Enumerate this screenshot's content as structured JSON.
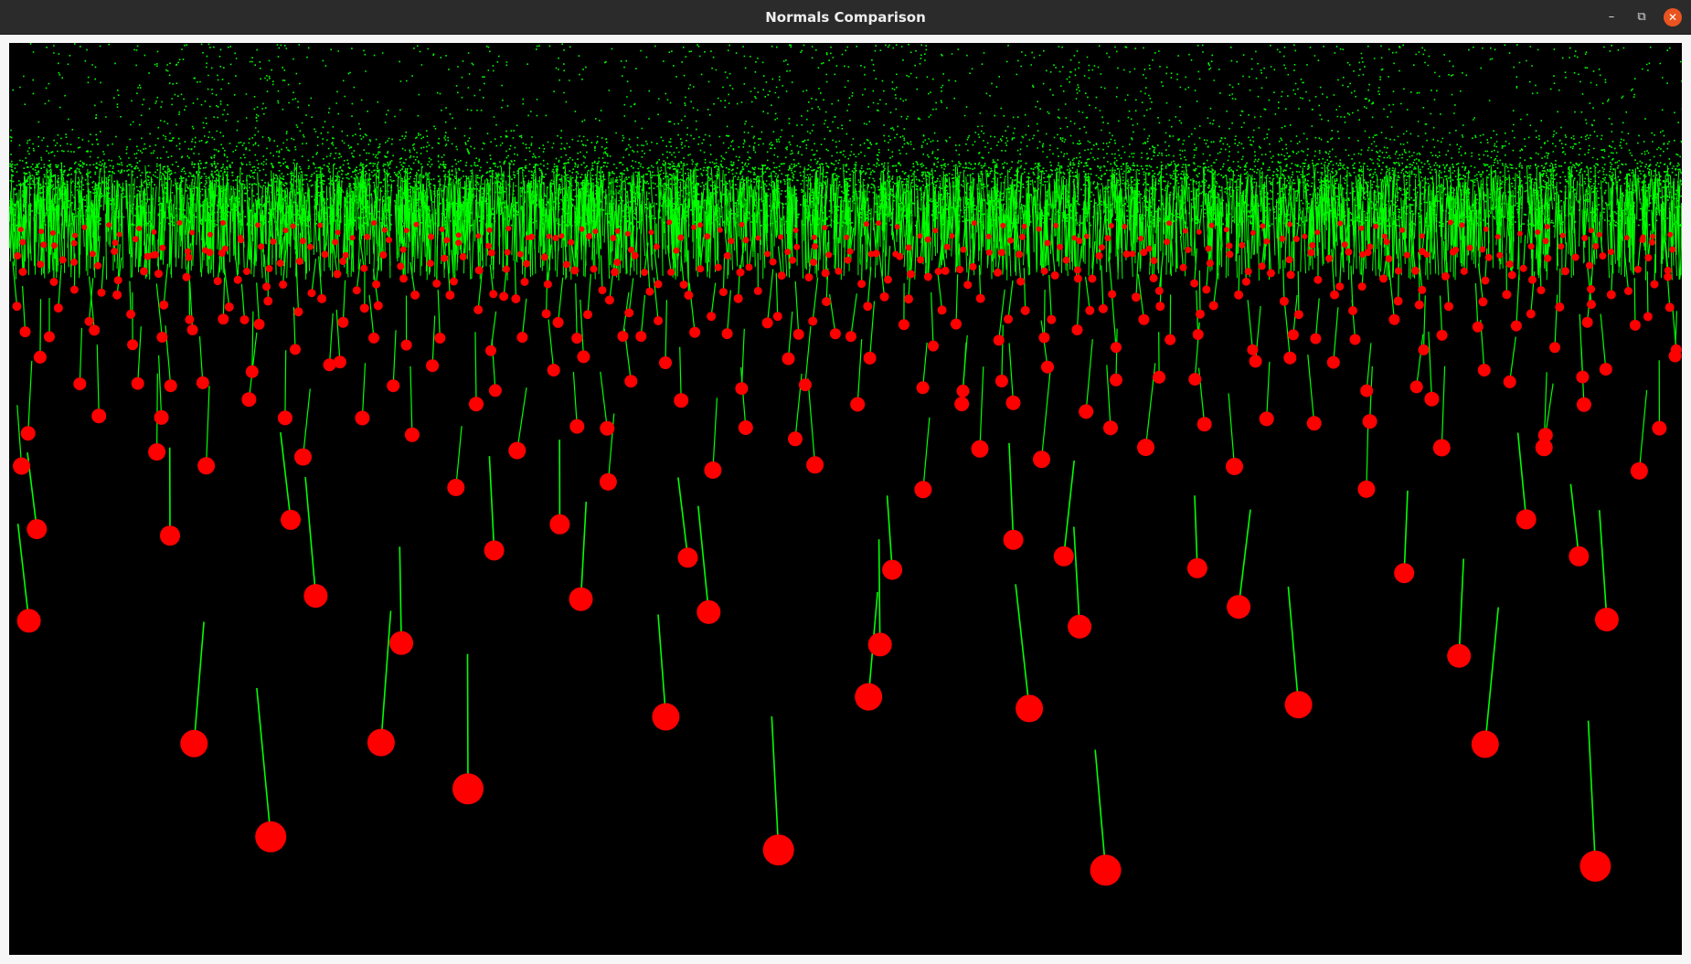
{
  "window": {
    "title": "Normals Comparison",
    "controls": {
      "minimize_icon": "minimize-icon",
      "maximize_icon": "restore-icon",
      "close_icon": "close-icon"
    }
  },
  "viewport": {
    "background": "#000000",
    "point_color": "#00ff00",
    "normal_color": "#00ff00",
    "marker_color": "#ff0000"
  },
  "theme": {
    "titlebar_bg": "#2b2b2b",
    "close_button_bg": "#e95420",
    "frame_bg": "#f6f6f6"
  }
}
